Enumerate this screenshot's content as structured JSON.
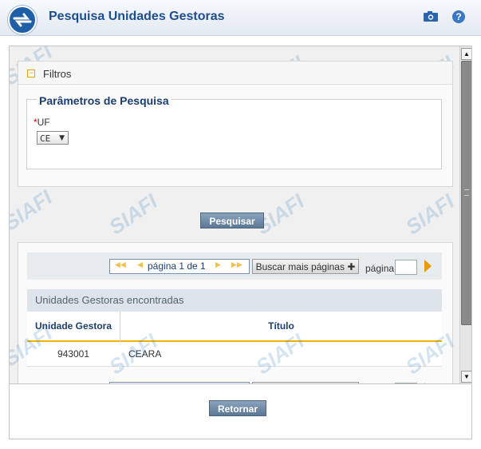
{
  "header": {
    "title": "Pesquisa Unidades Gestoras",
    "camera_icon": "camera-icon",
    "help_label": "?"
  },
  "watermark_text": "SIAFI",
  "filters": {
    "section_label": "Filtros",
    "fieldset_legend": "Parâmetros de Pesquisa",
    "uf_required_mark": "*",
    "uf_label": "UF",
    "uf_value": "CE",
    "search_button": "Pesquisar"
  },
  "pager": {
    "page_text": "página 1 de 1",
    "more_pages_button": "Buscar mais páginas",
    "plus_glyph": "✚",
    "page_label": "página",
    "page_input_value": ""
  },
  "results": {
    "table_title": "Unidades Gestoras encontradas",
    "columns": [
      "Unidade Gestora",
      "Título"
    ],
    "rows": [
      {
        "code": "943001",
        "title": "CEARA"
      }
    ]
  },
  "footer": {
    "return_button": "Retornar"
  },
  "colors": {
    "title": "#1d4e8f",
    "button": "#5c7895",
    "accent": "#f0b400"
  }
}
